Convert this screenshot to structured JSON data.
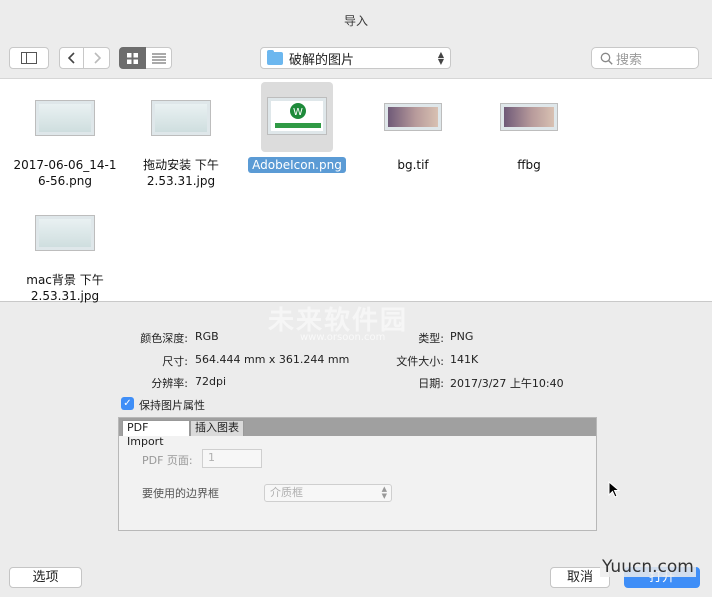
{
  "window": {
    "title": "导入"
  },
  "toolbar": {
    "folder_name": "破解的图片",
    "search_placeholder": "搜索",
    "icons": {
      "sidebar": "sidebar-icon",
      "back": "chevron-left-icon",
      "forward": "chevron-right-icon",
      "grid": "grid-view-icon",
      "list": "list-view-icon",
      "search": "search-icon"
    }
  },
  "files": [
    {
      "line1": "2017-06-06_14-1",
      "line2": "6-56.png"
    },
    {
      "line1": "拖动安装 下午",
      "line2": "2.53.31.jpg"
    },
    {
      "line1": "AdobeIcon.png",
      "line2": "",
      "selected": true
    },
    {
      "line1": "bg.tif",
      "line2": ""
    },
    {
      "line1": "ffbg",
      "line2": ""
    },
    {
      "line1": "mac背景 下午",
      "line2": "2.53.31.jpg"
    }
  ],
  "info": {
    "color_depth_label": "颜色深度:",
    "color_depth_value": "RGB",
    "size_label": "尺寸:",
    "size_value": "564.444 mm x 361.244 mm",
    "resolution_label": "分辨率:",
    "resolution_value": "72dpi",
    "type_label": "类型:",
    "type_value": "PNG",
    "filesize_label": "文件大小:",
    "filesize_value": "141K",
    "date_label": "日期:",
    "date_value": "2017/3/27  上午10:40"
  },
  "options": {
    "keep_attributes_label": "保持图片属性",
    "tab_pdf": "PDF Import",
    "tab_insert": "插入图表",
    "pdf_page_label": "PDF 页面:",
    "pdf_page_value": "1",
    "bounding_box_label": "要使用的边界框",
    "bounding_box_value": "介质框"
  },
  "buttons": {
    "options": "选项",
    "cancel": "取消",
    "open": "打开"
  },
  "watermark": {
    "text": "未来软件园",
    "url": "www.orsoon.com",
    "corner": "Yuucn.com"
  },
  "colors": {
    "accent": "#3f8ef7",
    "selection": "#5b9bd5"
  }
}
